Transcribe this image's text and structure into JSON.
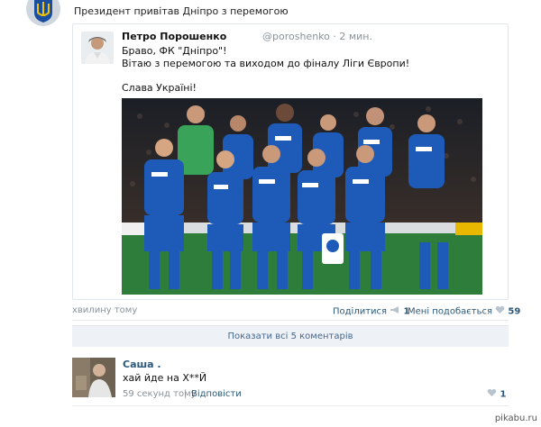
{
  "post": {
    "title": "Президент привітав Дніпро з перемогою"
  },
  "tweet": {
    "author": "Петро Порошенко",
    "handle": "@poroshenko · 2 мин.",
    "line1": "Браво, ФК \"Дніпро\"!",
    "line2": "Вітаю з перемогою та виходом до фіналу Ліги Європи!",
    "line3": "Слава Україні!"
  },
  "meta": {
    "time": "хвилину тому",
    "share_label": "Поділитися",
    "share_count": "1",
    "like_label": "Мені подобається",
    "like_count": "59"
  },
  "comments_toggle": "Показати всі 5 коментарів",
  "comment": {
    "author": "Саша .",
    "text": "хай йде на Х**Й",
    "time": "59 секунд тому",
    "reply_label": "Відповісти",
    "likes": "1"
  },
  "watermark": "pikabu.ru",
  "colors": {
    "link": "#2b587a",
    "muted": "#8a9299",
    "kit_blue": "#1e5bb8",
    "pitch_green": "#2f7d3a"
  }
}
